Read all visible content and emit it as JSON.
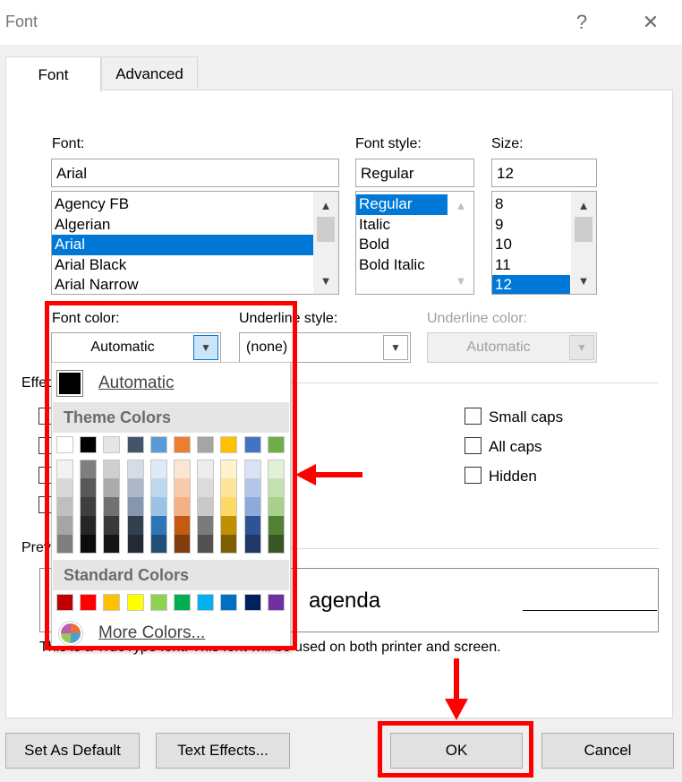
{
  "dialog": {
    "title": "Font",
    "help": "?",
    "close": "✕"
  },
  "tabs": [
    {
      "label": "Font"
    },
    {
      "label": "Advanced"
    }
  ],
  "font": {
    "label": "Font:",
    "value": "Arial",
    "list": [
      "Agency FB",
      "Algerian",
      "Arial",
      "Arial Black",
      "Arial Narrow"
    ],
    "selected_index": 2
  },
  "style": {
    "label": "Font style:",
    "value": "Regular",
    "list": [
      "Regular",
      "Italic",
      "Bold",
      "Bold Italic"
    ],
    "selected_index": 0
  },
  "size": {
    "label": "Size:",
    "value": "12",
    "list": [
      "8",
      "9",
      "10",
      "11",
      "12"
    ],
    "selected_index": 4
  },
  "font_color": {
    "label": "Font color:",
    "value": "Automatic"
  },
  "underline_style": {
    "label": "Underline style:",
    "value": "(none)"
  },
  "underline_color": {
    "label": "Underline color:",
    "value": "Automatic"
  },
  "effects": {
    "label": "Effects",
    "right_checkboxes": [
      {
        "label": "Small caps"
      },
      {
        "label": "All caps"
      },
      {
        "label": "Hidden"
      }
    ]
  },
  "preview": {
    "label": "Preview",
    "sample": "agenda",
    "note": "This is a TrueType font. This font will be used on both printer and screen."
  },
  "color_popup": {
    "automatic_label": "Automatic",
    "theme_label": "Theme Colors",
    "standard_label": "Standard Colors",
    "more_label": "More Colors...",
    "theme_top": [
      "#ffffff",
      "#000000",
      "#e7e6e6",
      "#44546a",
      "#5b9bd5",
      "#ed7d31",
      "#a5a5a5",
      "#ffc000",
      "#4472c4",
      "#70ad47"
    ],
    "theme_shades": [
      [
        "#f2f2f2",
        "#7f7f7f",
        "#d0cece",
        "#d6dce4",
        "#deebf6",
        "#fbe5d5",
        "#ededed",
        "#fff2cc",
        "#d9e2f3",
        "#e2efd9"
      ],
      [
        "#d8d8d8",
        "#595959",
        "#aeabab",
        "#adb9ca",
        "#bdd7ee",
        "#f7cbac",
        "#dbdbdb",
        "#fee599",
        "#b4c6e7",
        "#c5e0b3"
      ],
      [
        "#bfbfbf",
        "#3f3f3f",
        "#757070",
        "#8496b0",
        "#9cc3e5",
        "#f4b183",
        "#c9c9c9",
        "#ffd965",
        "#8eaadb",
        "#a8d08d"
      ],
      [
        "#a5a5a5",
        "#262626",
        "#3a3838",
        "#323f4f",
        "#2e75b5",
        "#c55a11",
        "#7b7b7b",
        "#bf9000",
        "#2f5496",
        "#538135"
      ],
      [
        "#7f7f7f",
        "#0c0c0c",
        "#171616",
        "#222a35",
        "#1e4e79",
        "#833c0b",
        "#525252",
        "#7f6000",
        "#1f3864",
        "#375623"
      ]
    ],
    "standard": [
      "#c00000",
      "#ff0000",
      "#ffc000",
      "#ffff00",
      "#92d050",
      "#00b050",
      "#00b0f0",
      "#0070c0",
      "#002060",
      "#7030a0"
    ]
  },
  "buttons": {
    "set_default": "Set As Default",
    "text_effects": "Text Effects...",
    "ok": "OK",
    "cancel": "Cancel"
  },
  "colors": {
    "highlight": "#ff0000",
    "selection": "#0078d7"
  }
}
